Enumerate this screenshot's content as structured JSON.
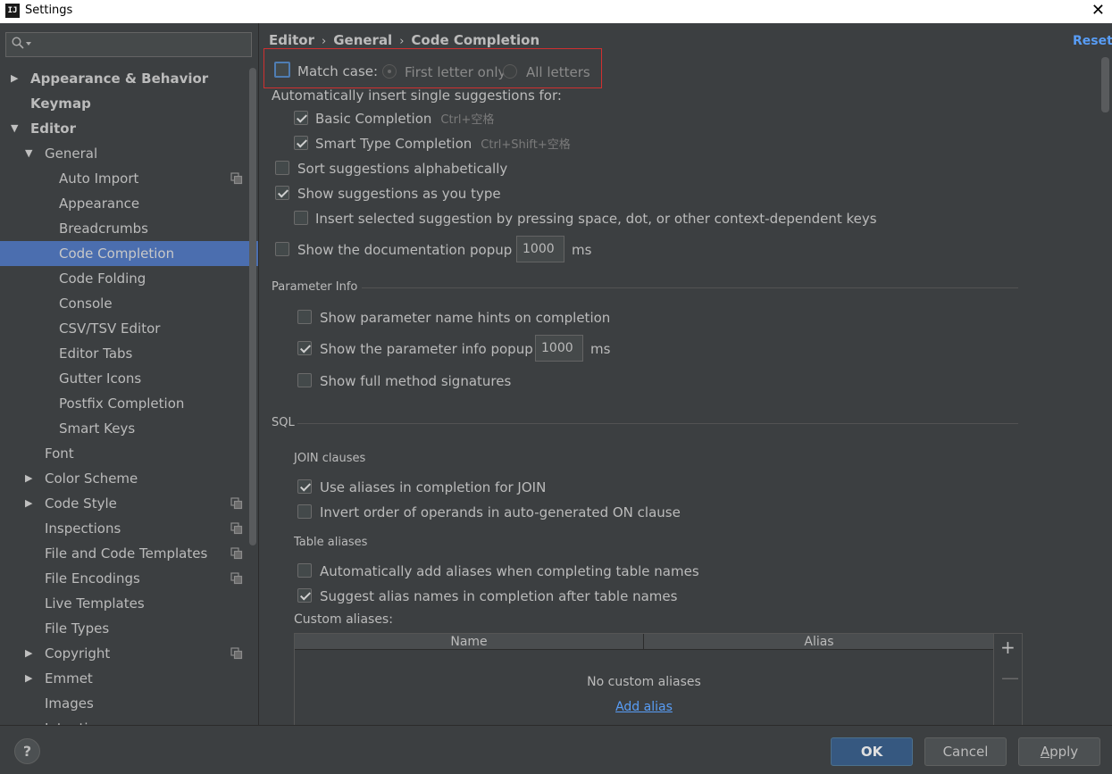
{
  "window": {
    "title": "Settings",
    "app_icon": "IJ",
    "close_glyph": "✕"
  },
  "sidebar": {
    "search_placeholder": "",
    "items": [
      {
        "label": "Appearance & Behavior",
        "level": 0,
        "arrow": "▶",
        "bold": true
      },
      {
        "label": "Keymap",
        "level": 0,
        "arrow": "",
        "bold": true
      },
      {
        "label": "Editor",
        "level": 0,
        "arrow": "▼",
        "bold": true
      },
      {
        "label": "General",
        "level": 1,
        "arrow": "▼"
      },
      {
        "label": "Auto Import",
        "level": 2,
        "copy": true
      },
      {
        "label": "Appearance",
        "level": 2
      },
      {
        "label": "Breadcrumbs",
        "level": 2
      },
      {
        "label": "Code Completion",
        "level": 2,
        "selected": true
      },
      {
        "label": "Code Folding",
        "level": 2
      },
      {
        "label": "Console",
        "level": 2
      },
      {
        "label": "CSV/TSV Editor",
        "level": 2
      },
      {
        "label": "Editor Tabs",
        "level": 2
      },
      {
        "label": "Gutter Icons",
        "level": 2
      },
      {
        "label": "Postfix Completion",
        "level": 2
      },
      {
        "label": "Smart Keys",
        "level": 2
      },
      {
        "label": "Font",
        "level": 1
      },
      {
        "label": "Color Scheme",
        "level": 1,
        "arrow": "▶"
      },
      {
        "label": "Code Style",
        "level": 1,
        "arrow": "▶",
        "copy": true
      },
      {
        "label": "Inspections",
        "level": 1,
        "copy": true
      },
      {
        "label": "File and Code Templates",
        "level": 1,
        "copy": true
      },
      {
        "label": "File Encodings",
        "level": 1,
        "copy": true
      },
      {
        "label": "Live Templates",
        "level": 1
      },
      {
        "label": "File Types",
        "level": 1
      },
      {
        "label": "Copyright",
        "level": 1,
        "arrow": "▶",
        "copy": true
      },
      {
        "label": "Emmet",
        "level": 1,
        "arrow": "▶"
      },
      {
        "label": "Images",
        "level": 1
      },
      {
        "label": "Intentions",
        "level": 1
      }
    ]
  },
  "breadcrumb": {
    "items": [
      "Editor",
      "General",
      "Code Completion"
    ],
    "separator": "›"
  },
  "reset_label": "Reset",
  "match_case": {
    "label": "Match case:",
    "checked": false,
    "option_first": "First letter only",
    "option_all": "All letters"
  },
  "auto_insert": {
    "heading": "Automatically insert single suggestions for:",
    "basic": {
      "label": "Basic Completion",
      "shortcut": "Ctrl+空格",
      "checked": true
    },
    "smart": {
      "label": "Smart Type Completion",
      "shortcut": "Ctrl+Shift+空格",
      "checked": true
    }
  },
  "sort_alpha": {
    "label": "Sort suggestions alphabetically",
    "checked": false
  },
  "show_as_type": {
    "label": "Show suggestions as you type",
    "checked": true
  },
  "insert_selected": {
    "label": "Insert selected suggestion by pressing space, dot, or other context-dependent keys",
    "checked": false
  },
  "doc_popup": {
    "label": "Show the documentation popup in",
    "value": "1000",
    "unit": "ms",
    "checked": false
  },
  "param_info": {
    "title": "Parameter Info",
    "hints": {
      "label": "Show parameter name hints on completion",
      "checked": false
    },
    "popup": {
      "label": "Show the parameter info popup in",
      "value": "1000",
      "unit": "ms",
      "checked": true
    },
    "full_sig": {
      "label": "Show full method signatures",
      "checked": false
    }
  },
  "sql": {
    "title": "SQL",
    "join_title": "JOIN clauses",
    "use_aliases": {
      "label": "Use aliases in completion for JOIN",
      "checked": true
    },
    "invert_order": {
      "label": "Invert order of operands in auto-generated ON clause",
      "checked": false
    },
    "table_aliases_title": "Table aliases",
    "auto_add": {
      "label": "Automatically add aliases when completing table names",
      "checked": false
    },
    "suggest_alias": {
      "label": "Suggest alias names in completion after table names",
      "checked": true
    },
    "custom_label": "Custom aliases:",
    "table": {
      "col_name": "Name",
      "col_alias": "Alias",
      "empty": "No custom aliases",
      "add_link": "Add alias",
      "plus": "+",
      "minus": "—"
    }
  },
  "buttons": {
    "help": "?",
    "ok": "OK",
    "cancel": "Cancel",
    "apply_underlined": "A",
    "apply_rest": "pply"
  },
  "colors": {
    "accent": "#4b6eaf",
    "link": "#589df6",
    "primary_button": "#365880",
    "highlight_box": "#d03030"
  }
}
